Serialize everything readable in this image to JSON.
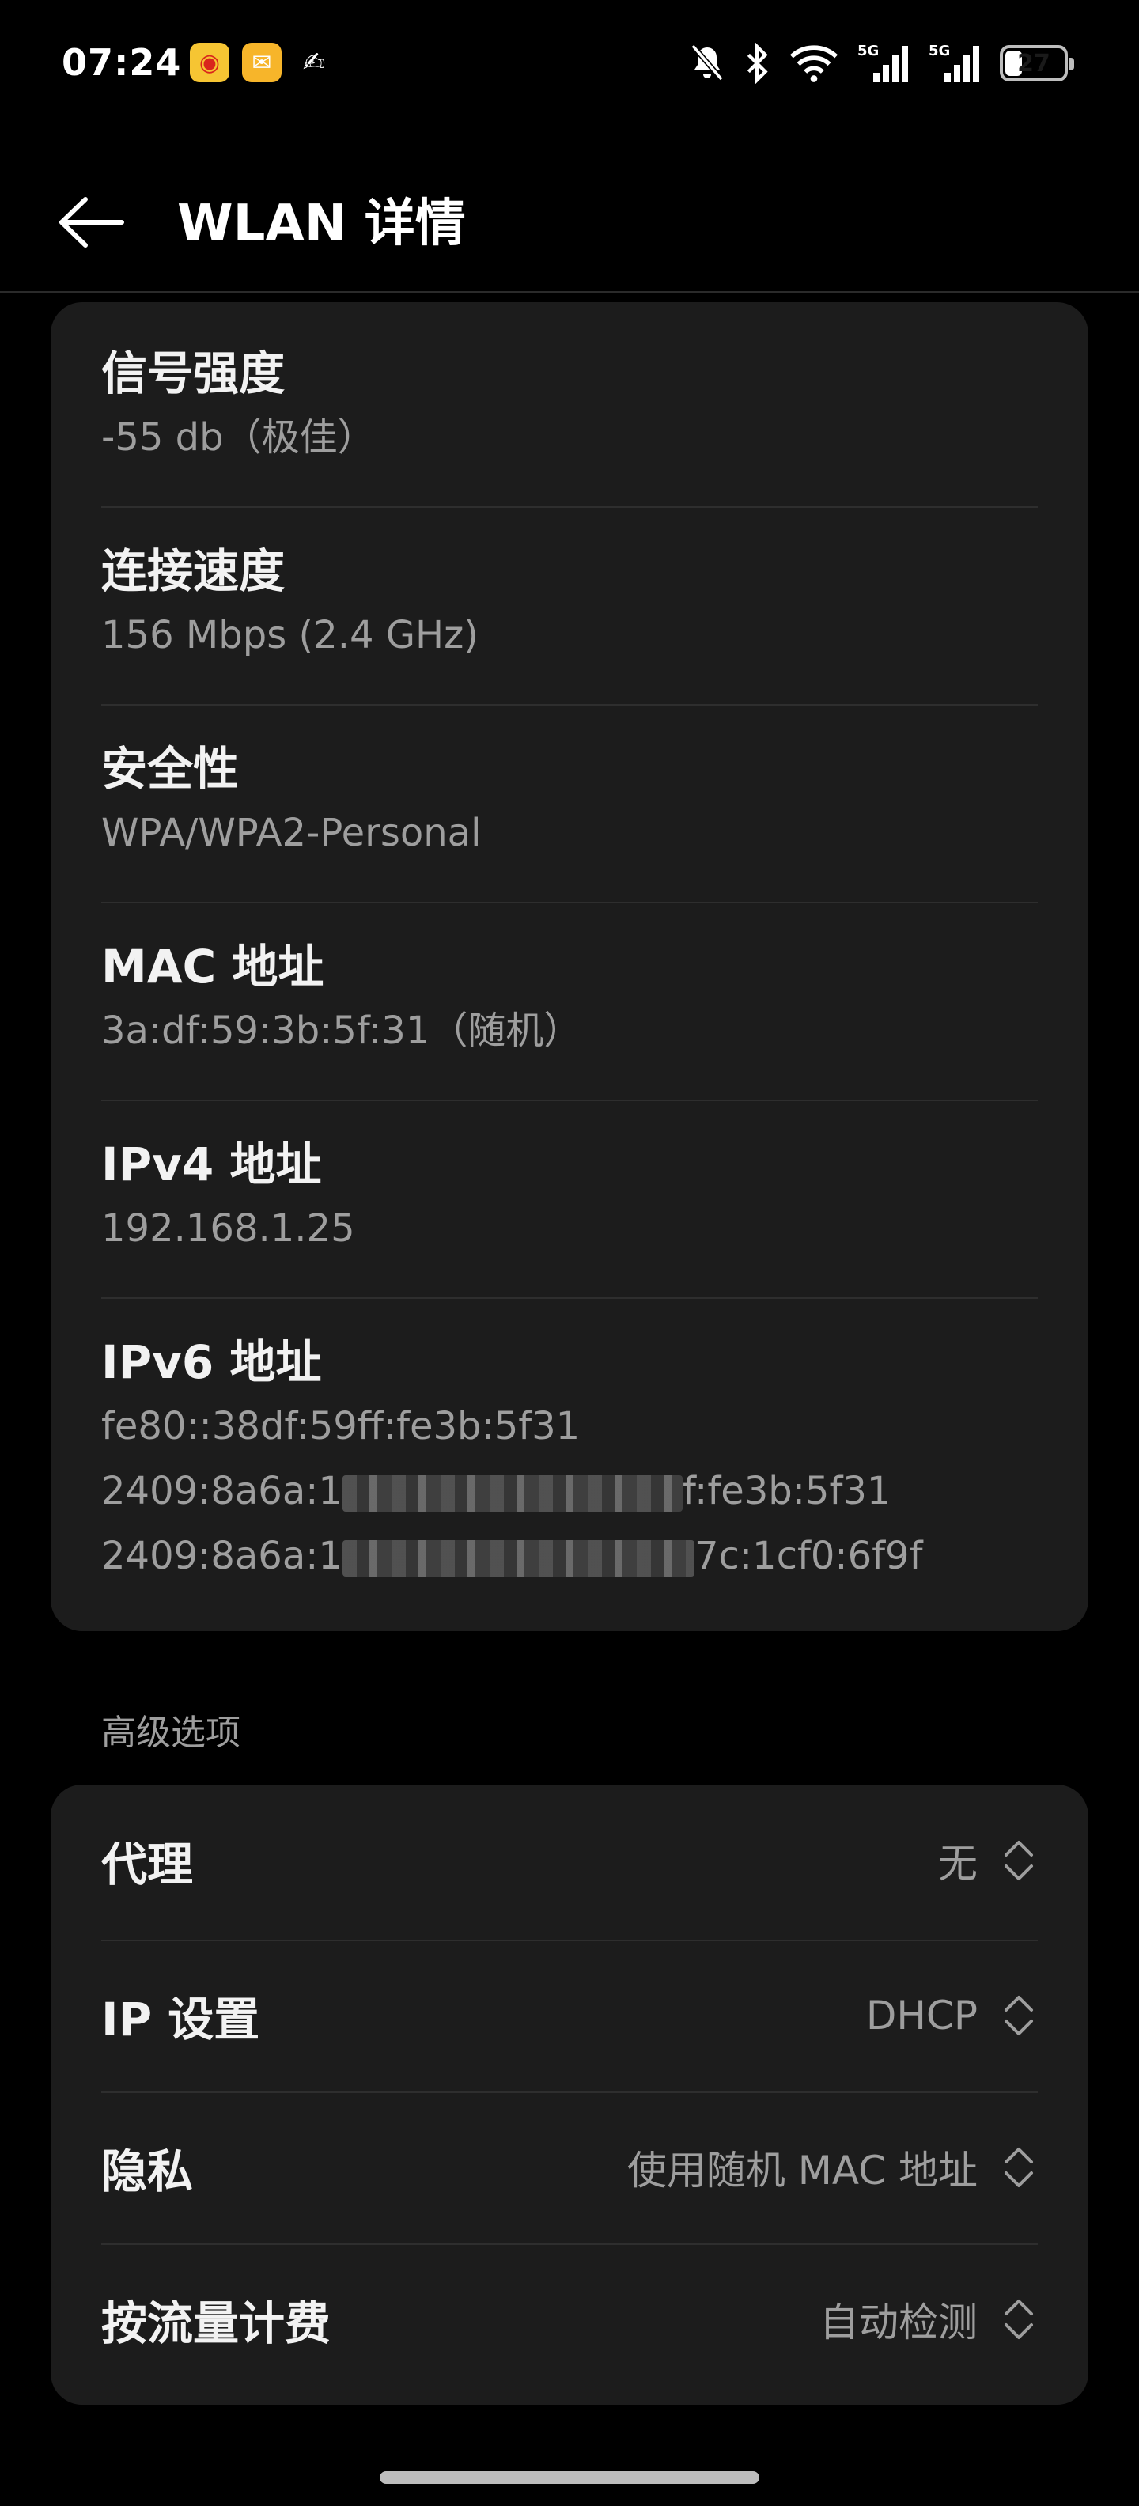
{
  "status_bar": {
    "time": "07:24",
    "battery_level": "27",
    "battery_fraction": 0.27,
    "icons": [
      "weibo-app-icon",
      "mail-app-icon",
      "pen-app-icon",
      "bell-muted-icon",
      "bluetooth-icon",
      "wifi-icon",
      "signal-5g-icon",
      "signal-5g-icon",
      "battery-icon"
    ],
    "signal_label_1": "5G",
    "signal_label_2": "5G"
  },
  "header": {
    "title": "WLAN 详情"
  },
  "details": [
    {
      "label": "信号强度",
      "value": "-55 db（极佳）"
    },
    {
      "label": "连接速度",
      "value": "156 Mbps (2.4 GHz)"
    },
    {
      "label": "安全性",
      "value": "WPA/WPA2-Personal"
    },
    {
      "label": "MAC 地址",
      "value": "3a:df:59:3b:5f:31（随机）"
    },
    {
      "label": "IPv4 地址",
      "value": "192.168.1.25"
    }
  ],
  "ipv6": {
    "label": "IPv6 地址",
    "line1": "fe80::38df:59ff:fe3b:5f31",
    "line2_prefix": "2409:8a6a:1",
    "line2_suffix": "f:fe3b:5f31",
    "line3_prefix": "2409:8a6a:1",
    "line3_suffix": "7c:1cf0:6f9f"
  },
  "advanced": {
    "section_label": "高级选项",
    "rows": [
      {
        "label": "代理",
        "value": "无"
      },
      {
        "label": "IP 设置",
        "value": "DHCP"
      },
      {
        "label": "隐私",
        "value": "使用随机 MAC 地址"
      },
      {
        "label": "按流量计费",
        "value": "自动检测"
      }
    ]
  },
  "colors": {
    "background": "#000000",
    "card": "#1c1c1c",
    "primary_text": "#f2f2f2",
    "secondary_text": "#9e9e9e",
    "divider": "#2e2e2e"
  }
}
